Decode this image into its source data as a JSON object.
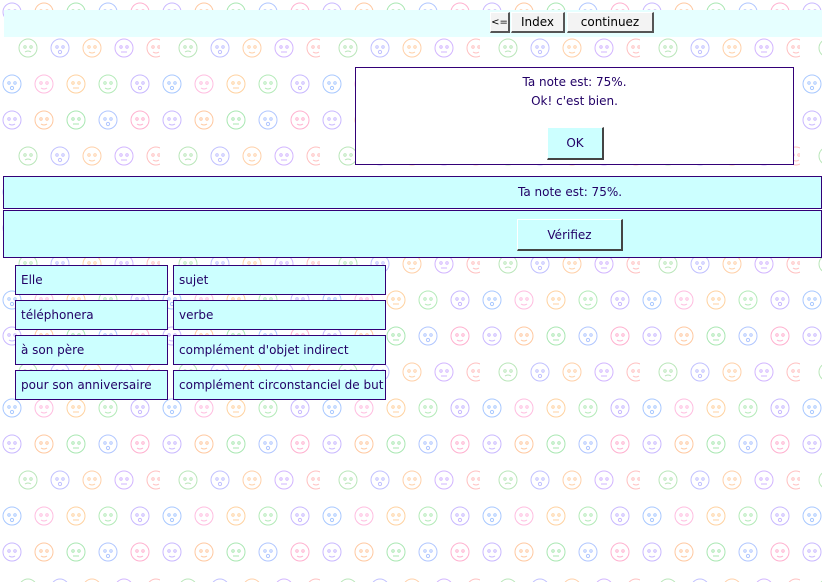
{
  "nav": {
    "back_label": "<=",
    "index_label": "Index",
    "continue_label": "continuez"
  },
  "dialog": {
    "score_text": "Ta note est: 75%.",
    "message": "Ok! c'est bien.",
    "ok_label": "OK"
  },
  "score_bar": {
    "text": "Ta note est: 75%."
  },
  "verify": {
    "label": "Vérifiez"
  },
  "rows": [
    {
      "word": "Elle",
      "function": "sujet"
    },
    {
      "word": "téléphonera",
      "function": "verbe"
    },
    {
      "word": "à son père",
      "function": "complément d'objet indirect"
    },
    {
      "word": "pour son anniversaire",
      "function": "complément circonstanciel de but"
    }
  ],
  "colors": {
    "panel": "#ccffff",
    "topbar": "#e6ffff",
    "text": "#220066",
    "border": "#330077"
  },
  "background": {
    "pattern": "baby-face-doodles"
  }
}
